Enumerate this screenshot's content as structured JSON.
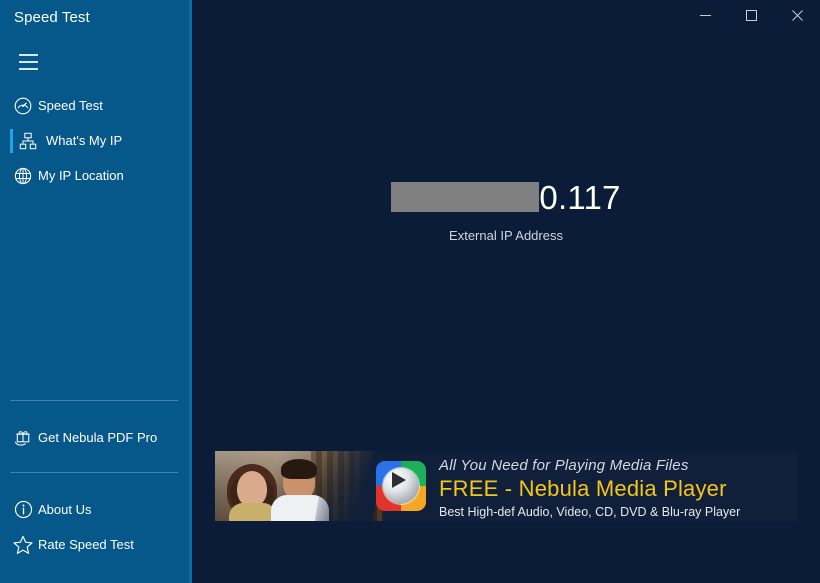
{
  "window": {
    "title": "Speed Test",
    "controls": [
      {
        "name": "minimize",
        "glyph": "minimize-icon",
        "tooltip": "Minimize"
      },
      {
        "name": "maximize",
        "glyph": "maximize-icon",
        "tooltip": "Maximize"
      },
      {
        "name": "close",
        "glyph": "close-icon",
        "tooltip": "Close"
      }
    ]
  },
  "sidebar": {
    "menu_button": "hamburger-menu-icon",
    "nav_items": [
      {
        "label": "Speed Test",
        "icon": "speedometer-icon",
        "selected": false
      },
      {
        "label": "What's My IP",
        "icon": "network-icon",
        "selected": true
      },
      {
        "label": "My IP Location",
        "icon": "globe-icon",
        "selected": false
      }
    ],
    "promo_items": [
      {
        "label": "Get Nebula PDF Pro",
        "icon": "gift-icon"
      }
    ],
    "footer_items": [
      {
        "label": "About Us",
        "icon": "info-icon"
      },
      {
        "label": "Rate Speed Test",
        "icon": "star-icon"
      }
    ]
  },
  "main": {
    "ip_value_visible": "0.117",
    "ip_redacted": true,
    "ip_caption": "External IP Address"
  },
  "advertisement": {
    "headline": "All You Need for Playing Media Files",
    "product": "FREE - Nebula Media Player",
    "tagline": "Best High-def Audio, Video, CD, DVD & Blu-ray Player",
    "logo": "media-player-logo"
  },
  "colors": {
    "sidebar_bg": "#06578a",
    "sidebar_edge": "#0a6ba6",
    "main_bg": "#0a1c38",
    "selection_bar": "#1ea7e8",
    "redaction": "#808080",
    "ad_bg": "#11203a",
    "ad_accent": "#f5c518"
  }
}
